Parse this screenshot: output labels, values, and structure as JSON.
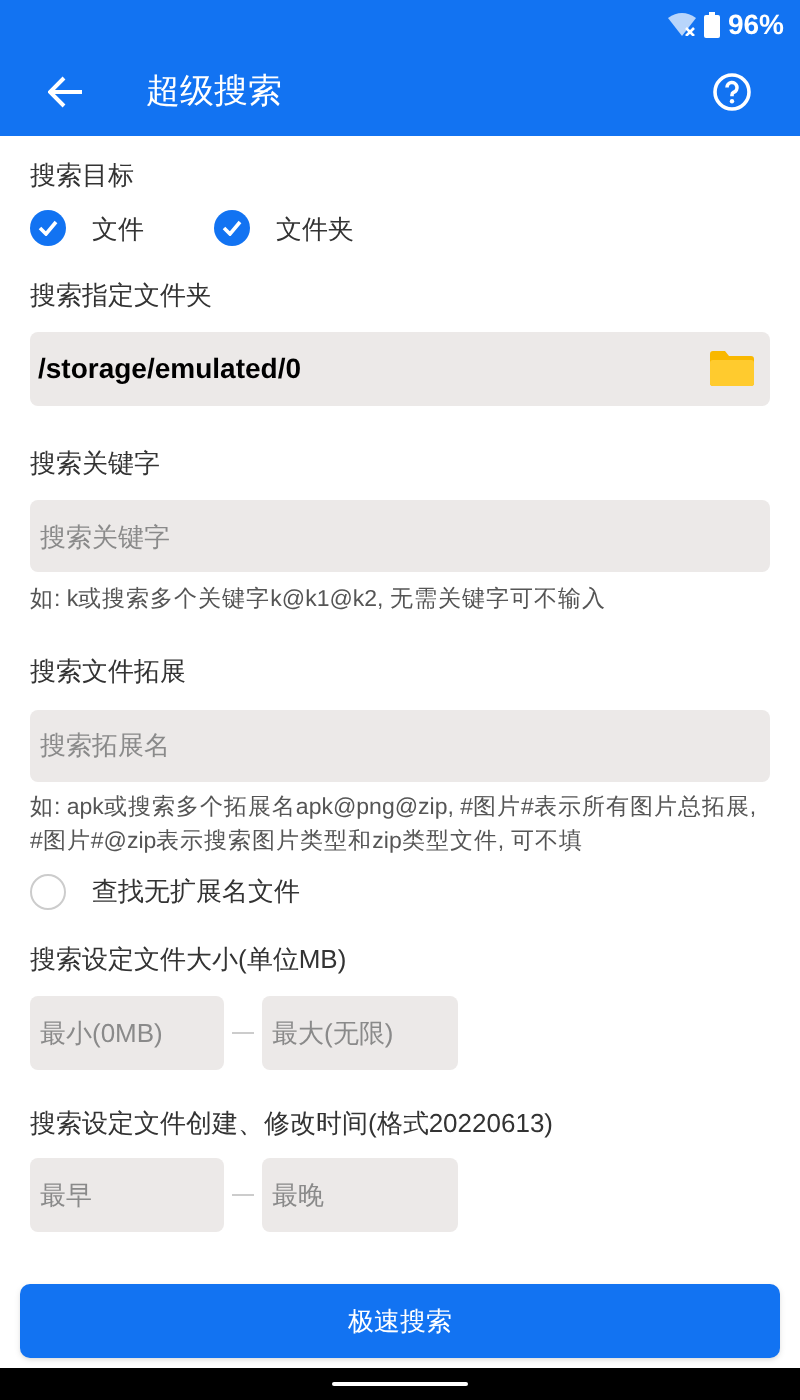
{
  "status_bar": {
    "battery": "96%"
  },
  "app_bar": {
    "title": "超级搜索"
  },
  "target": {
    "label": "搜索目标",
    "options": [
      {
        "label": "文件",
        "checked": true
      },
      {
        "label": "文件夹",
        "checked": true
      }
    ]
  },
  "folder": {
    "label": "搜索指定文件夹",
    "value": "/storage/emulated/0"
  },
  "keyword": {
    "label": "搜索关键字",
    "placeholder": "搜索关键字",
    "hint": "如: k或搜索多个关键字k@k1@k2, 无需关键字可不输入"
  },
  "extension": {
    "label": "搜索文件拓展",
    "placeholder": "搜索拓展名",
    "hint": "如: apk或搜索多个拓展名apk@png@zip, #图片#表示所有图片总拓展, #图片#@zip表示搜索图片类型和zip类型文件, 可不填",
    "no_ext": {
      "label": "查找无扩展名文件",
      "checked": false
    }
  },
  "size": {
    "label": "搜索设定文件大小(单位MB)",
    "min_placeholder": "最小(0MB)",
    "max_placeholder": "最大(无限)"
  },
  "time": {
    "label": "搜索设定文件创建、修改时间(格式20220613)",
    "min_placeholder": "最早",
    "max_placeholder": "最晚"
  },
  "search_button": "极速搜索"
}
